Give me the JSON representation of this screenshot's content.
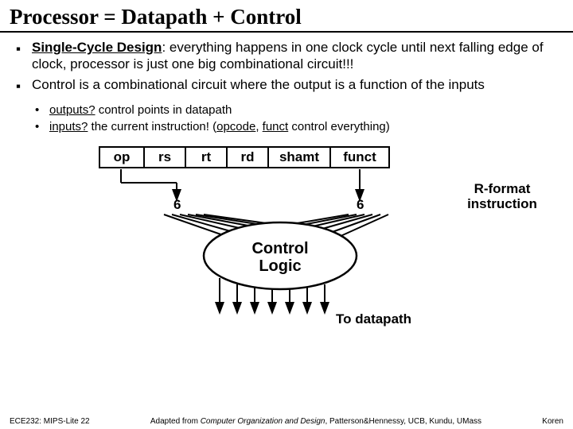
{
  "title": "Processor = Datapath + Control",
  "bullets": {
    "b1_lead": "Single-Cycle Design",
    "b1_rest": ": everything happens in one clock cycle until next falling edge of clock, processor is just one big combinational circuit!!!",
    "b2": "Control is a combinational circuit where the output is a function of the inputs"
  },
  "subs": {
    "s1_q": "outputs?",
    "s1_a": " control points in datapath",
    "s2_q": "inputs?",
    "s2_a_pre": "  the current instruction! (",
    "s2_a_op": "opcode",
    "s2_a_mid": ", ",
    "s2_a_fn": "funct",
    "s2_a_post": " control everything)"
  },
  "fields": {
    "op": "op",
    "rs": "rs",
    "rt": "rt",
    "rd": "rd",
    "shamt": "shamt",
    "funct": "funct"
  },
  "labels": {
    "six_left": "6",
    "six_right": "6",
    "rformat_l1": "R-format",
    "rformat_l2": "instruction",
    "control_l1": "Control",
    "control_l2": "Logic",
    "to_dp": "To datapath"
  },
  "footer": {
    "left": "ECE232: MIPS-Lite 22",
    "mid_pre": "Adapted from ",
    "mid_it": "Computer Organization and Design",
    "mid_post": ", Patterson&Hennessy, UCB, Kundu, UMass",
    "right": "Koren"
  }
}
